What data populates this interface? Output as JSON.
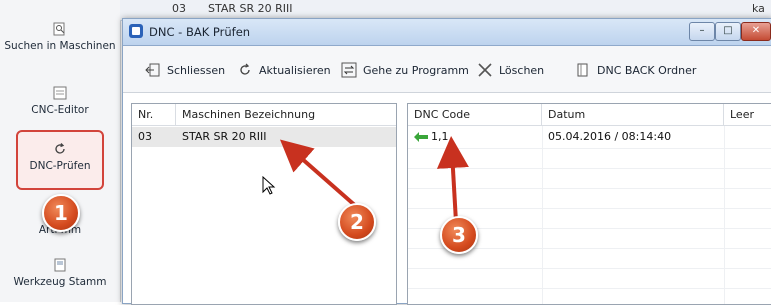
{
  "sidebar": {
    "items": [
      {
        "label": "Suchen in Maschinen",
        "icon": "search-icon"
      },
      {
        "label": "CNC-Editor",
        "icon": "editor-icon"
      },
      {
        "label": "DNC-Prüfen",
        "icon": "refresh-icon"
      },
      {
        "label": "Arti          mm",
        "icon": "article-icon"
      },
      {
        "label": "Werkzeug Stamm",
        "icon": "tool-icon"
      }
    ]
  },
  "background_window": {
    "row_code": "03",
    "row_name": "STAR SR 20 RIII",
    "right_text": "ka"
  },
  "dialog": {
    "title": "DNC - BAK Prüfen",
    "window_buttons": {
      "minimize": "–",
      "maximize": "□",
      "close": "✕"
    },
    "toolbar": {
      "schliessen": "Schliessen",
      "aktualisieren": "Aktualisieren",
      "gehe_zu_programm": "Gehe zu Programm",
      "loeschen": "Löschen",
      "dnc_back_ordner": "DNC BACK Ordner"
    },
    "left_table": {
      "headers": [
        "Nr.",
        "Maschinen Bezeichnung"
      ],
      "rows": [
        {
          "nr": "03",
          "name": "STAR SR 20 RIII"
        }
      ]
    },
    "right_table": {
      "headers": [
        "DNC Code",
        "Datum",
        "Leer"
      ],
      "rows": [
        {
          "code": "1,1",
          "datum": "05.04.2016 / 08:14:40",
          "leer": ""
        }
      ]
    }
  },
  "callouts": [
    "1",
    "2",
    "3"
  ],
  "colors": {
    "callout": "#d44a1e",
    "arrow": "#c8311f",
    "highlight_border": "#d2443b",
    "green_arrow": "#3aa63a"
  }
}
